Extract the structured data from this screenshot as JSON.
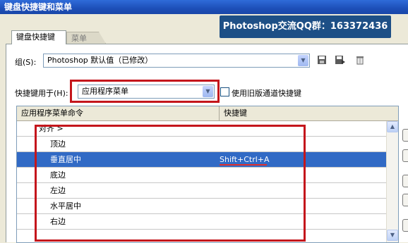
{
  "window": {
    "title": "键盘快捷键和菜单"
  },
  "banner": {
    "text": "Photoshop交流QQ群：163372436"
  },
  "tabs": [
    {
      "label": "键盘快捷键",
      "active": true
    },
    {
      "label": "菜单",
      "active": false
    }
  ],
  "set_row": {
    "label": "组(S):",
    "value": "Photoshop 默认值（已修改）"
  },
  "shortcuts_for": {
    "label": "快捷键用于(H):",
    "value": "应用程序菜单",
    "legacy_channel_label": "使用旧版通道快捷键",
    "legacy_channel_checked": false
  },
  "table": {
    "columns": [
      "应用程序菜单命令",
      "快捷键"
    ],
    "rows": [
      {
        "command": "对齐 >",
        "shortcut": "",
        "group": true,
        "selected": false
      },
      {
        "command": "顶边",
        "shortcut": "",
        "group": false,
        "selected": false
      },
      {
        "command": "垂直居中",
        "shortcut": "Shift+Ctrl+A",
        "group": false,
        "selected": true
      },
      {
        "command": "底边",
        "shortcut": "",
        "group": false,
        "selected": false
      },
      {
        "command": "左边",
        "shortcut": "",
        "group": false,
        "selected": false
      },
      {
        "command": "水平居中",
        "shortcut": "",
        "group": false,
        "selected": false
      },
      {
        "command": "右边",
        "shortcut": "",
        "group": false,
        "selected": false
      }
    ]
  },
  "colors": {
    "selection": "#316ac5",
    "highlight_box": "#c4161c",
    "banner_bg": "#1d4f86"
  },
  "icons": [
    "save-set-icon",
    "save-set-as-icon",
    "delete-set-icon",
    "scroll-up-icon",
    "scroll-down-icon",
    "dropdown-arrow-icon"
  ]
}
